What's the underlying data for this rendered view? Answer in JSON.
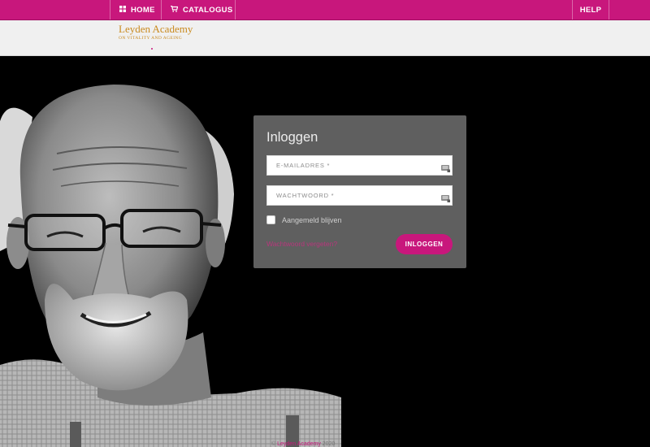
{
  "nav": {
    "home_label": "HOME",
    "catalogus_label": "CATALOGUS",
    "help_label": "HELP",
    "home_icon": "grid-icon",
    "catalogus_icon": "cart-icon"
  },
  "logo": {
    "title": "Leyden Academy",
    "subtitle": "ON VITALITY AND AGEING"
  },
  "login": {
    "title": "Inloggen",
    "email_placeholder": "E-MAILADRES *",
    "password_placeholder": "WACHTWOORD *",
    "remember_label": "Aangemeld blijven",
    "forgot_label": "Wachtwoord vergeten?",
    "submit_label": "INLOGGEN"
  },
  "footer": {
    "copyright_symbol": "©",
    "company_link": "Leyden Academy",
    "year": "2020"
  },
  "colors": {
    "accent": "#c8177c",
    "logo_gold": "#c98a1e",
    "panel": "#5f5f5f"
  }
}
